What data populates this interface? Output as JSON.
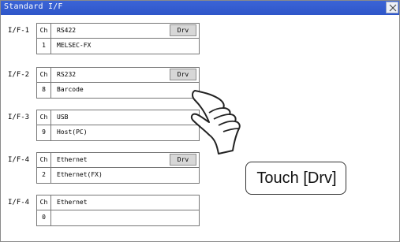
{
  "window": {
    "title": "Standard I/F"
  },
  "interfaces": [
    {
      "if_label": "I/F-1",
      "ch_label": "Ch",
      "interface": "RS422",
      "channel": "1",
      "device": "MELSEC-FX",
      "drv_label": "Drv"
    },
    {
      "if_label": "I/F-2",
      "ch_label": "Ch",
      "interface": "RS232",
      "channel": "8",
      "device": "Barcode",
      "drv_label": "Drv"
    },
    {
      "if_label": "I/F-3",
      "ch_label": "Ch",
      "interface": "USB",
      "channel": "9",
      "device": "Host(PC)",
      "drv_label": ""
    },
    {
      "if_label": "I/F-4",
      "ch_label": "Ch",
      "interface": "Ethernet",
      "channel": "2",
      "device": "Ethernet(FX)",
      "drv_label": "Drv"
    },
    {
      "if_label": "I/F-4",
      "ch_label": "Ch",
      "interface": "Ethernet",
      "channel": "0",
      "device": "",
      "drv_label": ""
    }
  ],
  "callout": {
    "text": "Touch [Drv]"
  },
  "icons": {
    "close": "close-icon",
    "hand": "pointing-hand-icon"
  }
}
